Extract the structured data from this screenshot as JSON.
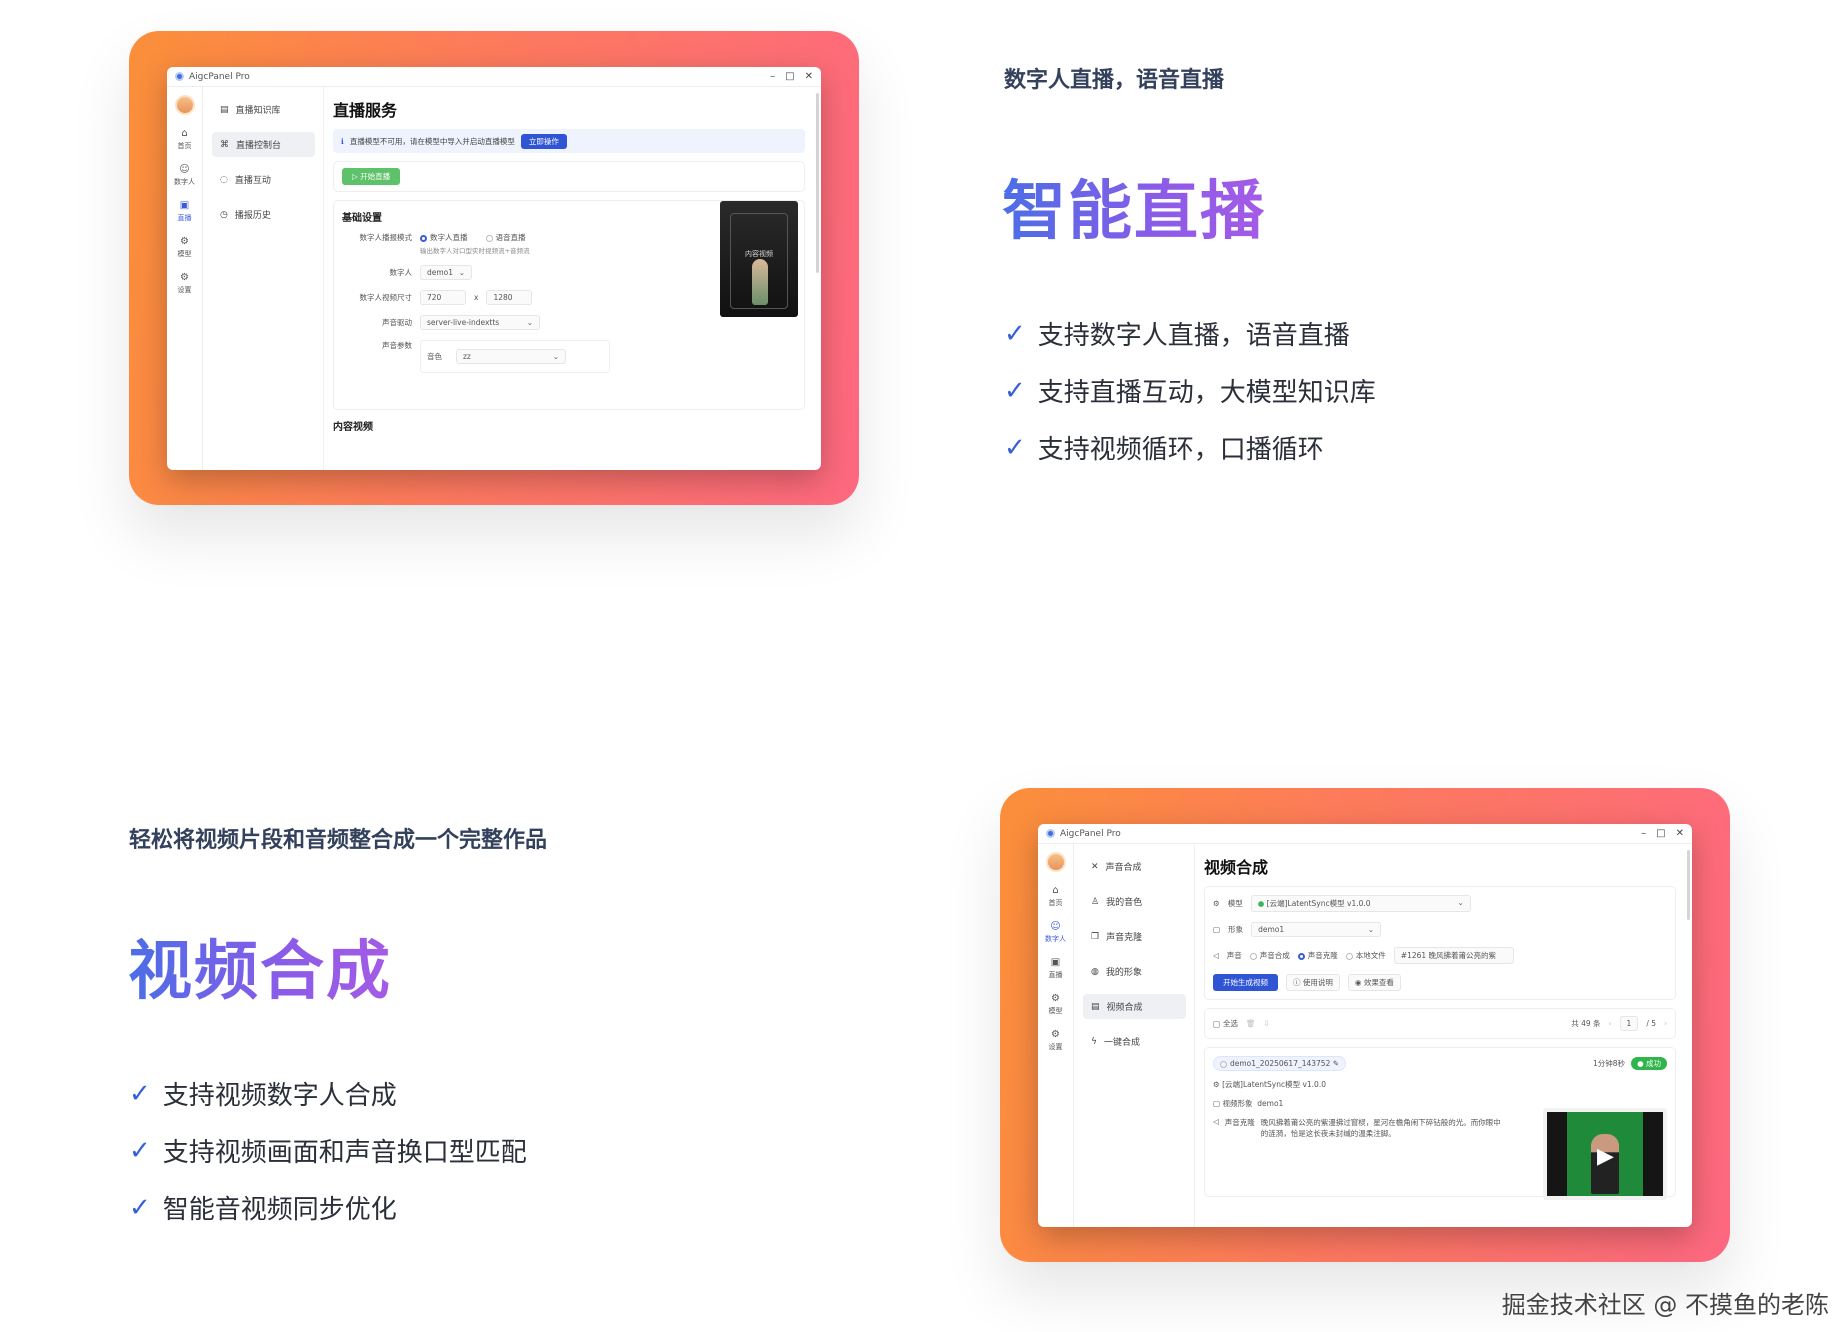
{
  "live": {
    "eyebrow": "数字人直播，语音直播",
    "headline": "智能直播",
    "features": [
      "支持数字人直播，语音直播",
      "支持直播互动，大模型知识库",
      "支持视频循环，口播循环"
    ],
    "window": {
      "title": "AigcPanel Pro",
      "rail": [
        {
          "icon": "⌂",
          "label": "首页"
        },
        {
          "icon": "☺",
          "label": "数字人"
        },
        {
          "icon": "▣",
          "label": "直播"
        },
        {
          "icon": "⚙",
          "label": "模型"
        },
        {
          "icon": "⚙",
          "label": "设置"
        }
      ],
      "menu": [
        "直播知识库",
        "直播控制台",
        "直播互动",
        "播报历史"
      ],
      "page_title": "直播服务",
      "notice": "直播模型不可用，请在模型中导入并启动直播模型",
      "notice_button": "立即操作",
      "start_button": "▷ 开始直播",
      "basic_title": "基础设置",
      "mode_label": "数字人播报模式",
      "mode_options": [
        "数字人直播",
        "语音直播"
      ],
      "mode_hint": "输出数字人对口型实时视频流+音频流",
      "avatar_label": "数字人",
      "avatar_value": "demo1",
      "size_label": "数字人视频尺寸",
      "size_w": "720",
      "size_x": "x",
      "size_h": "1280",
      "voice_label": "声音驱动",
      "voice_value": "server-live-indextts",
      "param_label": "声音参数",
      "timbre_label": "音色",
      "timbre_value": "zz",
      "content_title": "内容视频",
      "preview_label": "内容视频"
    }
  },
  "video": {
    "eyebrow": "轻松将视频片段和音频整合成一个完整作品",
    "headline": "视频合成",
    "features": [
      "支持视频数字人合成",
      "支持视频画面和声音换口型匹配",
      "智能音视频同步优化"
    ],
    "window": {
      "title": "AigcPanel Pro",
      "rail": [
        {
          "icon": "⌂",
          "label": "首页"
        },
        {
          "icon": "☺",
          "label": "数字人"
        },
        {
          "icon": "▣",
          "label": "直播"
        },
        {
          "icon": "⚙",
          "label": "模型"
        },
        {
          "icon": "⚙",
          "label": "设置"
        }
      ],
      "menu": [
        "声音合成",
        "我的音色",
        "声音克隆",
        "我的形象",
        "视频合成",
        "一键合成"
      ],
      "page_title": "视频合成",
      "model_label": "模型",
      "model_value": "[云端]LatentSync模型 v1.0.0",
      "figure_label": "形象",
      "figure_value": "demo1",
      "sound_label": "声音",
      "sound_options": [
        "声音合成",
        "声音克隆",
        "本地文件"
      ],
      "sound_value": "#1261 晚风拂着莆公亮的紫",
      "gen_button": "开始生成视频",
      "help_button": "使用说明",
      "effect_button": "效果查看",
      "select_all": "全选",
      "total": "共 49 条",
      "page_current": "1",
      "page_total": "/ 5",
      "task_name": "demo1_20250617_143752",
      "task_duration": "1分钟8秒",
      "task_status": "成功",
      "task_model": "[云端]LatentSync模型 v1.0.0",
      "task_figure_label": "视频形象",
      "task_figure": "demo1",
      "task_voice_label": "声音克隆",
      "task_text": "晚风拂着莆公亮的紫漫拂过窗棂，星河在檐角闹下碎钻般的光。而你眼中的涟漪，恰是这长夜未封缄的温柔注脚。"
    }
  },
  "watermark": "掘金技术社区 @ 不摸鱼的老陈"
}
